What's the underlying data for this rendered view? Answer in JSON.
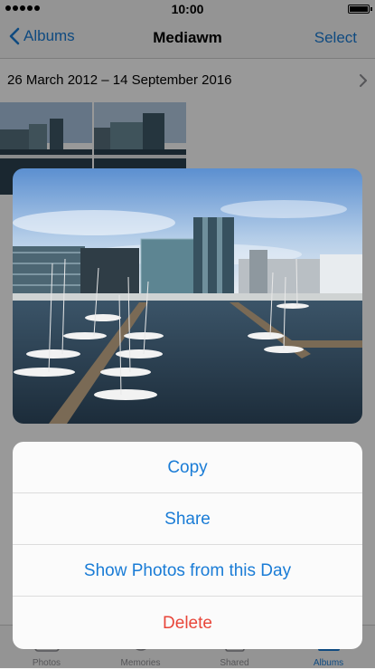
{
  "status_bar": {
    "time": "10:00"
  },
  "nav": {
    "back_label": "Albums",
    "title": "Mediawm",
    "select_label": "Select"
  },
  "album": {
    "date_range": "26 March 2012 – 14 September 2016"
  },
  "tabs": [
    {
      "label": "Photos",
      "icon": "photos-icon"
    },
    {
      "label": "Memories",
      "icon": "memories-icon"
    },
    {
      "label": "Shared",
      "icon": "shared-icon"
    },
    {
      "label": "Albums",
      "icon": "albums-icon",
      "active": true
    }
  ],
  "action_sheet": {
    "copy": "Copy",
    "share": "Share",
    "show_day": "Show Photos from this Day",
    "delete": "Delete"
  },
  "colors": {
    "accent": "#1a7cd6",
    "destructive": "#e8463a"
  }
}
